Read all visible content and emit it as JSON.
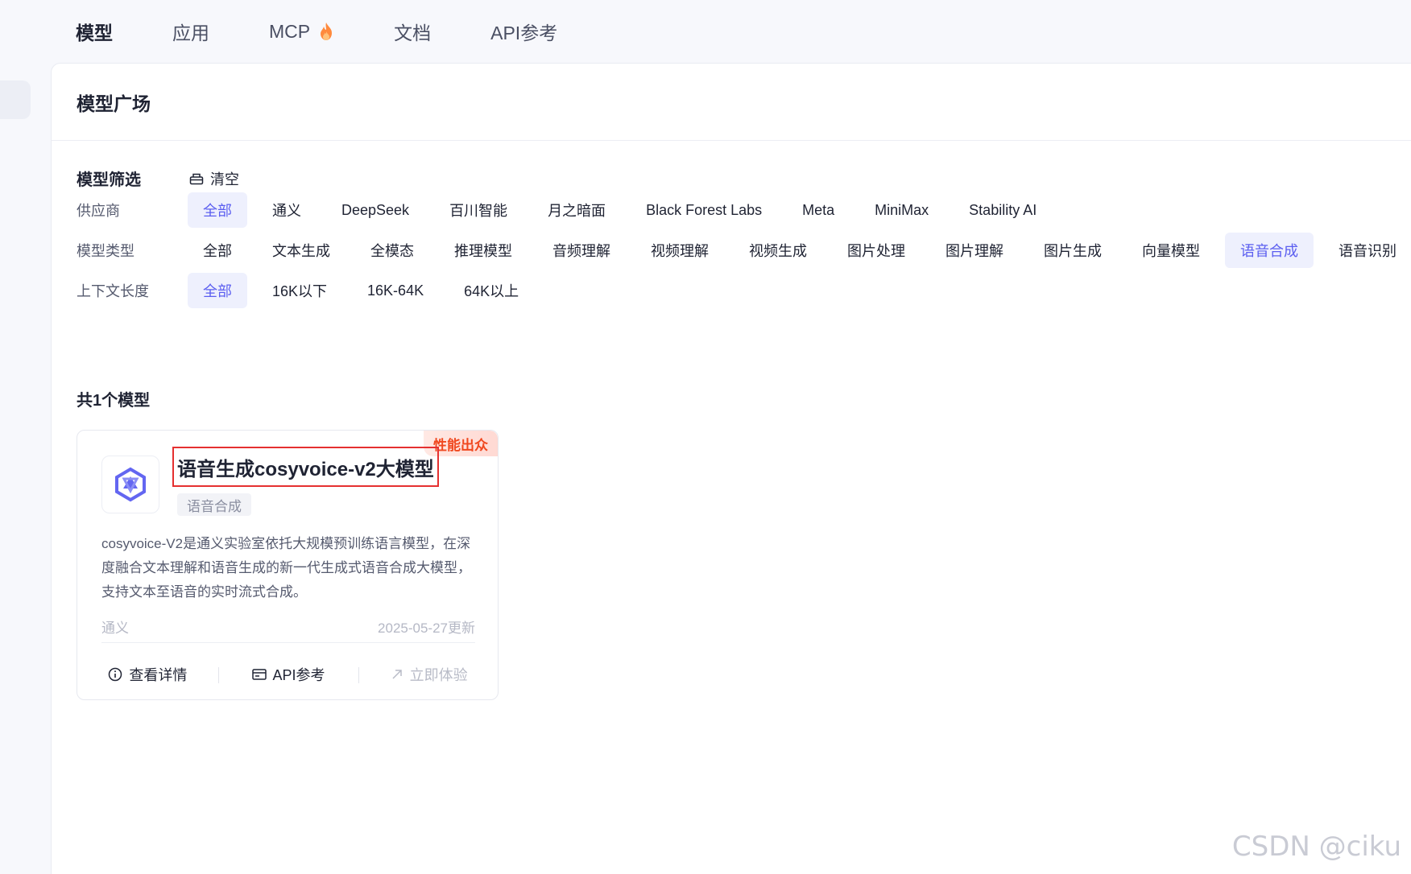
{
  "topnav": {
    "items": [
      {
        "label": "模型"
      },
      {
        "label": "应用"
      },
      {
        "label": "MCP"
      },
      {
        "label": "文档"
      },
      {
        "label": "API参考"
      }
    ]
  },
  "panel": {
    "title": "模型广场"
  },
  "filters": {
    "heading": "模型筛选",
    "clear_label": "清空",
    "provider": {
      "label": "供应商",
      "options": [
        "全部",
        "通义",
        "DeepSeek",
        "百川智能",
        "月之暗面",
        "Black Forest Labs",
        "Meta",
        "MiniMax",
        "Stability AI"
      ],
      "selected": "全部"
    },
    "model_type": {
      "label": "模型类型",
      "options": [
        "全部",
        "文本生成",
        "全模态",
        "推理模型",
        "音频理解",
        "视频理解",
        "视频生成",
        "图片处理",
        "图片理解",
        "图片生成",
        "向量模型",
        "语音合成",
        "语音识别"
      ],
      "selected": "语音合成"
    },
    "context_length": {
      "label": "上下文长度",
      "options": [
        "全部",
        "16K以下",
        "16K-64K",
        "64K以上"
      ],
      "selected": "全部"
    }
  },
  "results": {
    "count_label": "共1个模型"
  },
  "card": {
    "badge": "性能出众",
    "title": "语音生成cosyvoice-v2大模型",
    "tag": "语音合成",
    "description": "cosyvoice-V2是通义实验室依托大规模预训练语言模型，在深度融合文本理解和语音生成的新一代生成式语音合成大模型，支持文本至语音的实时流式合成。",
    "provider": "通义",
    "updated": "2025-05-27更新",
    "actions": {
      "details": "查看详情",
      "api": "API参考",
      "try": "立即体验"
    }
  },
  "watermark": "CSDN @ciku",
  "colors": {
    "accent": "#5b5ef0",
    "badge_text": "#f0481f",
    "highlight_border": "#e53030"
  }
}
